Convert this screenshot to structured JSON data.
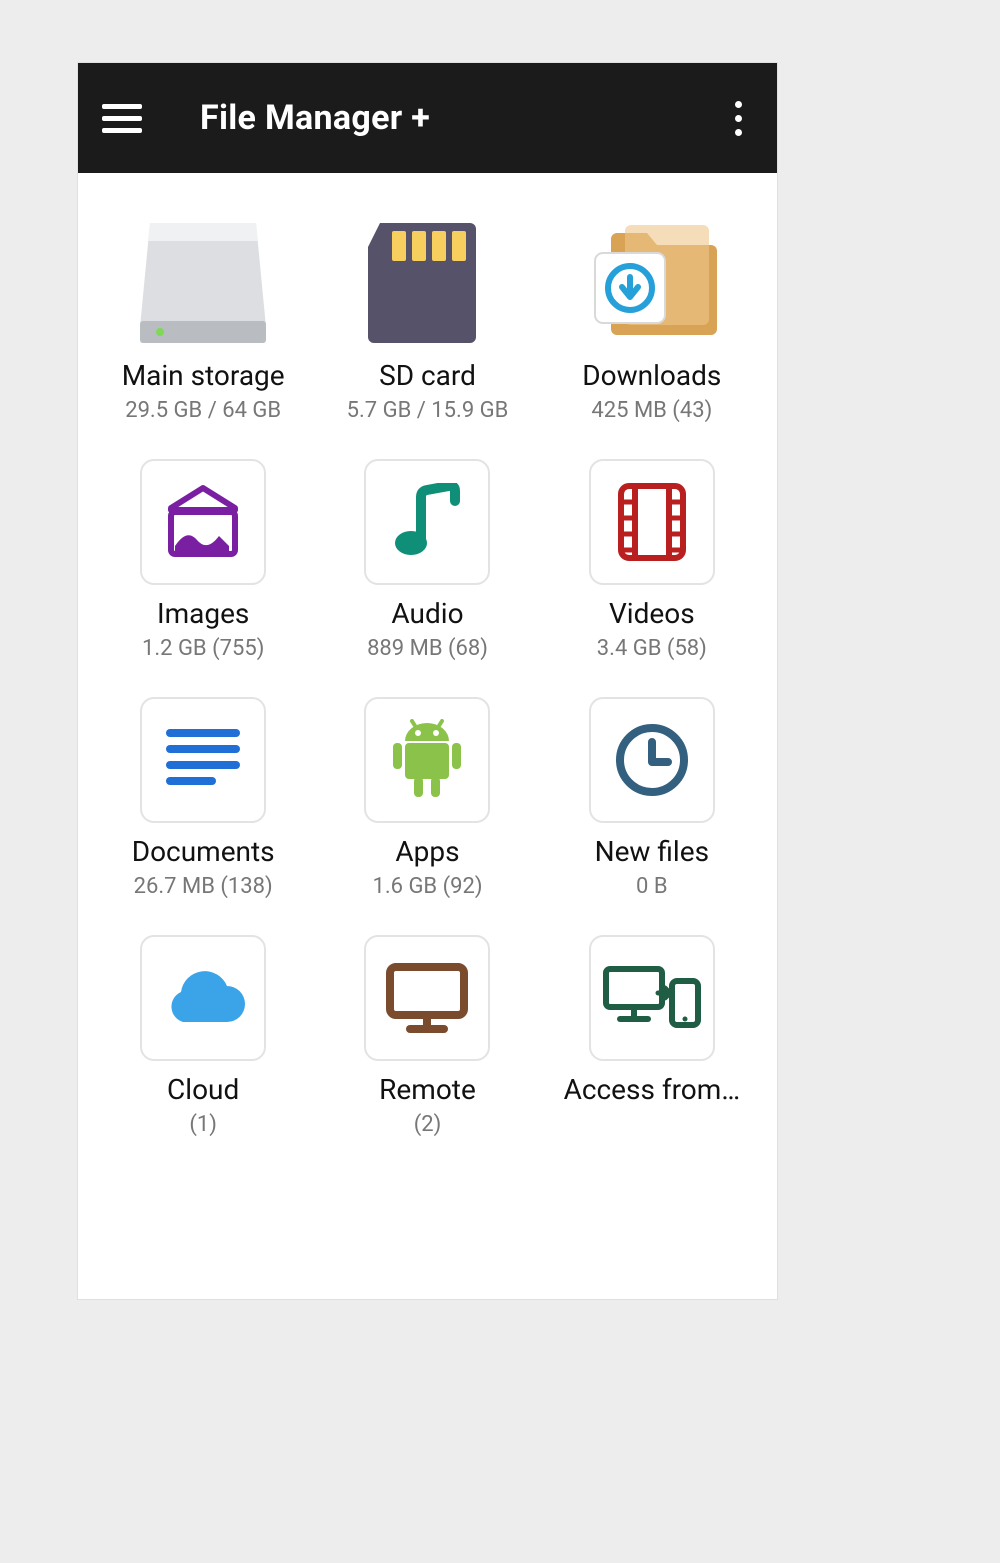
{
  "header": {
    "title": "File Manager +"
  },
  "items": [
    {
      "icon": "drive-icon",
      "label": "Main storage",
      "sub": "29.5 GB / 64 GB"
    },
    {
      "icon": "sdcard-icon",
      "label": "SD card",
      "sub": "5.7 GB / 15.9 GB"
    },
    {
      "icon": "downloads-icon",
      "label": "Downloads",
      "sub": "425 MB (43)"
    },
    {
      "icon": "image-icon",
      "label": "Images",
      "sub": "1.2 GB (755)"
    },
    {
      "icon": "audio-icon",
      "label": "Audio",
      "sub": "889 MB (68)"
    },
    {
      "icon": "video-icon",
      "label": "Videos",
      "sub": "3.4 GB (58)"
    },
    {
      "icon": "document-icon",
      "label": "Documents",
      "sub": "26.7 MB (138)"
    },
    {
      "icon": "apps-icon",
      "label": "Apps",
      "sub": "1.6 GB (92)"
    },
    {
      "icon": "clock-icon",
      "label": "New files",
      "sub": "0 B"
    },
    {
      "icon": "cloud-icon",
      "label": "Cloud",
      "sub": "(1)"
    },
    {
      "icon": "remote-icon",
      "label": "Remote",
      "sub": "(2)"
    },
    {
      "icon": "access-icon",
      "label": "Access from…",
      "sub": ""
    }
  ]
}
